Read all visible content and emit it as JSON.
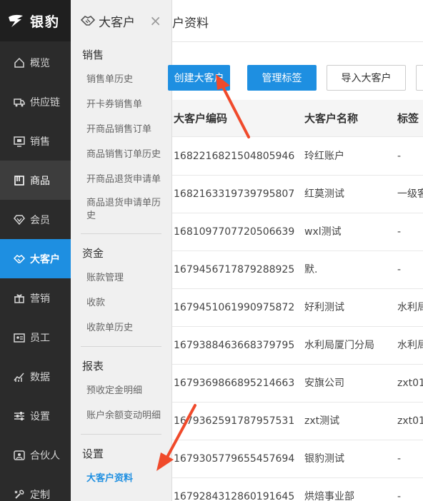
{
  "brand": {
    "name": "银豹"
  },
  "nav": {
    "items": [
      {
        "key": "overview",
        "label": "概览",
        "icon": "home-icon"
      },
      {
        "key": "supply",
        "label": "供应链",
        "icon": "truck-icon"
      },
      {
        "key": "sales",
        "label": "销售",
        "icon": "monitor-icon"
      },
      {
        "key": "goods",
        "label": "商品",
        "icon": "book-icon"
      },
      {
        "key": "member",
        "label": "会员",
        "icon": "diamond-icon"
      },
      {
        "key": "bigcustomer",
        "label": "大客户",
        "icon": "handshake-icon"
      },
      {
        "key": "marketing",
        "label": "营销",
        "icon": "gift-icon"
      },
      {
        "key": "staff",
        "label": "员工",
        "icon": "id-card-icon"
      },
      {
        "key": "data",
        "label": "数据",
        "icon": "chart-icon"
      },
      {
        "key": "settings",
        "label": "设置",
        "icon": "sliders-icon"
      },
      {
        "key": "partner",
        "label": "合伙人",
        "icon": "partner-icon"
      },
      {
        "key": "custom",
        "label": "定制",
        "icon": "wrench-icon"
      }
    ]
  },
  "subpanel": {
    "title": "大客户",
    "close": "×",
    "groups": [
      {
        "title": "销售",
        "items": [
          "销售单历史",
          "开卡券销售单",
          "开商品销售订单",
          "商品销售订单历史",
          "开商品退货申请单",
          "商品退货申请单历史"
        ]
      },
      {
        "title": "资金",
        "items": [
          "账款管理",
          "收款",
          "收款单历史"
        ]
      },
      {
        "title": "报表",
        "items": [
          "预收定金明细",
          "账户余额变动明细"
        ]
      },
      {
        "title": "设置",
        "items": [
          "大客户资料"
        ]
      }
    ]
  },
  "main": {
    "title": "户资料",
    "toolbar": {
      "create": "创建大客户",
      "tags": "管理标签",
      "import": "导入大客户"
    },
    "table": {
      "headers": [
        "大客户编码",
        "大客户名称",
        "标签"
      ],
      "rows": [
        [
          "1682216821504805946",
          "玲红账户",
          "-"
        ],
        [
          "1682163319739795807",
          "红莫测试",
          "一级客"
        ],
        [
          "1681097707720506639",
          "wxl测试",
          "-"
        ],
        [
          "1679456717879288925",
          "默.",
          "-"
        ],
        [
          "1679451061990975872",
          "好利测试",
          "水利局"
        ],
        [
          "1679388463668379795",
          "水利局厦门分局",
          "水利局"
        ],
        [
          "1679369866895214663",
          "安旗公司",
          "zxt01"
        ],
        [
          "1679362591787957531",
          "zxt测试",
          "zxt01"
        ],
        [
          "1679305779655457694",
          "银豹测试",
          "-"
        ],
        [
          "1679284312860191645",
          "烘焙事业部",
          "-"
        ]
      ]
    }
  },
  "colors": {
    "accent": "#1e8fe1",
    "nav_bg": "#2b2b2b",
    "arrow": "#f04a2b"
  }
}
